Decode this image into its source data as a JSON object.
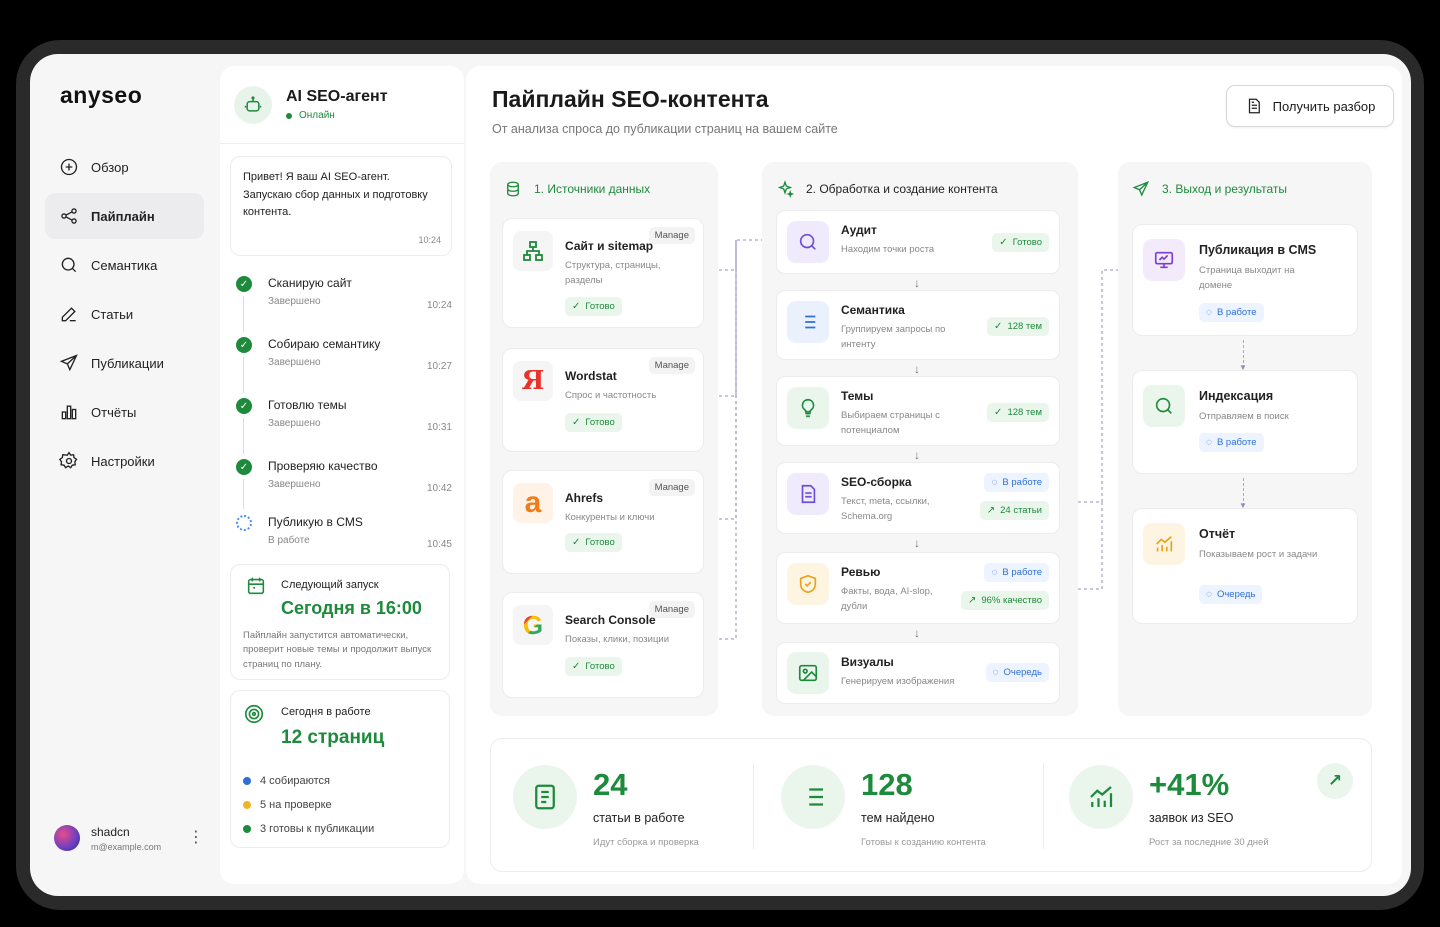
{
  "brand": "anyseo",
  "nav": {
    "items": [
      {
        "label": "Обзор",
        "icon": "plus-circle-icon"
      },
      {
        "label": "Пайплайн",
        "icon": "pipeline-icon"
      },
      {
        "label": "Семантика",
        "icon": "search-icon"
      },
      {
        "label": "Статьи",
        "icon": "pen-icon"
      },
      {
        "label": "Публикации",
        "icon": "send-icon"
      },
      {
        "label": "Отчёты",
        "icon": "bar-chart-icon"
      },
      {
        "label": "Настройки",
        "icon": "gear-icon"
      }
    ],
    "active": "Пайплайн"
  },
  "user": {
    "name": "shadcn",
    "email": "m@example.com"
  },
  "agent": {
    "title": "AI SEO-агент",
    "status": "Онлайн",
    "message": "Привет! Я ваш AI SEO-агент. Запускаю сбор данных и подготовку контента.",
    "message_time": "10:24",
    "steps": [
      {
        "title": "Сканирую сайт",
        "status": "Завершено",
        "time": "10:24"
      },
      {
        "title": "Собираю семантику",
        "status": "Завершено",
        "time": "10:27"
      },
      {
        "title": "Готовлю темы",
        "status": "Завершено",
        "time": "10:31"
      },
      {
        "title": "Проверяю качество",
        "status": "Завершено",
        "time": "10:42"
      },
      {
        "title": "Публикую в CMS",
        "status": "В работе",
        "time": "10:45"
      }
    ],
    "next_run": {
      "label": "Следующий запуск",
      "value": "Сегодня в 16:00",
      "desc": "Пайплайн запустится автоматически, проверит новые темы и продолжит выпуск страниц по плану."
    },
    "today": {
      "label": "Сегодня в работе",
      "value": "12 страниц",
      "items": [
        {
          "text": "4 собираются",
          "color": "#2f6fd6"
        },
        {
          "text": "5 на проверке",
          "color": "#f0b429"
        },
        {
          "text": "3 готовы к публикации",
          "color": "#1e8a3c"
        }
      ]
    }
  },
  "main": {
    "title": "Пайплайн SEO-контента",
    "subtitle": "От анализа спроса до публикации страниц на вашем сайте",
    "report_button": "Получить разбор"
  },
  "sources": {
    "heading": "1. Источники данных",
    "manage_label": "Manage",
    "items": [
      {
        "name": "Сайт и sitemap",
        "desc": "Структура, страницы, разделы",
        "status": "Готово",
        "icon": "sitemap-icon"
      },
      {
        "name": "Wordstat",
        "desc": "Спрос и частотность",
        "status": "Готово",
        "icon": "yandex-icon"
      },
      {
        "name": "Ahrefs",
        "desc": "Конкуренты и ключи",
        "status": "Готово",
        "icon": "ahrefs-icon"
      },
      {
        "name": "Search Console",
        "desc": "Показы, клики, позиции",
        "status": "Готово",
        "icon": "google-icon"
      }
    ]
  },
  "processing": {
    "heading": "2. Обработка и создание контента",
    "items": [
      {
        "name": "Аудит",
        "desc": "Находим точки роста",
        "badges": [
          {
            "text": "Готово",
            "kind": "ok"
          }
        ],
        "icon": "search-icon",
        "color": "#6b4fd8",
        "bg": "#efeafc"
      },
      {
        "name": "Семантика",
        "desc": "Группируем запросы по интенту",
        "badges": [
          {
            "text": "128 тем",
            "kind": "ok"
          }
        ],
        "icon": "list-icon",
        "color": "#2f6fd6",
        "bg": "#eaf1fd"
      },
      {
        "name": "Темы",
        "desc": "Выбираем страницы с потенциалом",
        "badges": [
          {
            "text": "128 тем",
            "kind": "ok"
          }
        ],
        "icon": "lightbulb-icon",
        "color": "#1e8a3c",
        "bg": "#eaf6ec"
      },
      {
        "name": "SEO-сборка",
        "desc": "Текст, meta, ссылки, Schema.org",
        "badges": [
          {
            "text": "В работе",
            "kind": "work"
          },
          {
            "text": "24 статьи",
            "kind": "ok"
          }
        ],
        "icon": "document-icon",
        "color": "#6b4fd8",
        "bg": "#efeafc"
      },
      {
        "name": "Ревью",
        "desc": "Факты, вода, AI-slop, дубли",
        "badges": [
          {
            "text": "В работе",
            "kind": "work"
          },
          {
            "text": "96% качество",
            "kind": "ok"
          }
        ],
        "icon": "shield-check-icon",
        "color": "#e8a21a",
        "bg": "#fdf4e2"
      },
      {
        "name": "Визуалы",
        "desc": "Генерируем изображения",
        "badges": [
          {
            "text": "Очередь",
            "kind": "queue"
          }
        ],
        "icon": "image-icon",
        "color": "#1e8a3c",
        "bg": "#eaf6ec"
      }
    ]
  },
  "output": {
    "heading": "3. Выход и результаты",
    "items": [
      {
        "name": "Публикация в CMS",
        "desc": "Страница выходит на домене",
        "status": "В работе",
        "icon": "monitor-icon",
        "color": "#7a3fd0",
        "bg": "#f3ebfc"
      },
      {
        "name": "Индексация",
        "desc": "Отправляем в поиск",
        "status": "В работе",
        "icon": "search-icon",
        "color": "#1e8a3c",
        "bg": "#eaf6ec"
      },
      {
        "name": "Отчёт",
        "desc": "Показываем рост и задачи",
        "status": "Очередь",
        "icon": "growth-chart-icon",
        "color": "#e8a21a",
        "bg": "#fdf4e2"
      }
    ]
  },
  "stats": [
    {
      "value": "24",
      "label": "статьи в работе",
      "desc": "Идут сборка и проверка",
      "icon": "document-icon"
    },
    {
      "value": "128",
      "label": "тем найдено",
      "desc": "Готовы к созданию контента",
      "icon": "list-icon"
    },
    {
      "value": "+41%",
      "label": "заявок из SEO",
      "desc": "Рост за последние 30 дней",
      "icon": "growth-chart-icon"
    }
  ],
  "colors": {
    "accent": "#1e8a3c",
    "blue": "#2f6fd6",
    "bg": "#f6f6f7"
  }
}
